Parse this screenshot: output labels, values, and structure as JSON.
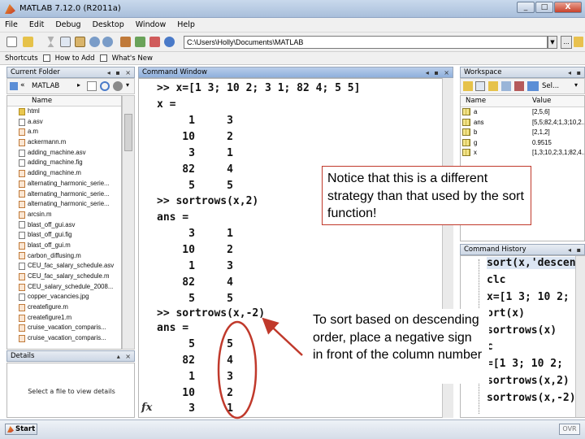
{
  "window": {
    "title": "MATLAB  7.12.0 (R2011a)",
    "minimize": "_",
    "maximize": "□",
    "close": "X"
  },
  "menu": [
    "File",
    "Edit",
    "Debug",
    "Desktop",
    "Window",
    "Help"
  ],
  "toolbar": {
    "current_folder_path": "C:\\Users\\Holly\\Documents\\MATLAB",
    "dropdown_glyph": "▼",
    "browse_label": "..."
  },
  "shortcuts": [
    {
      "label": "Shortcuts"
    },
    {
      "label": "How to Add"
    },
    {
      "label": "What's New"
    }
  ],
  "current_folder": {
    "header": "Current Folder",
    "folder_name": "MATLAB",
    "column_name": "Name",
    "files": [
      {
        "name": "html",
        "kind": "folder"
      },
      {
        "name": "a.asv",
        "kind": "file"
      },
      {
        "name": "a.m",
        "kind": "m"
      },
      {
        "name": "ackermann.m",
        "kind": "m"
      },
      {
        "name": "adding_machine.asv",
        "kind": "file"
      },
      {
        "name": "adding_machine.fig",
        "kind": "file"
      },
      {
        "name": "adding_machine.m",
        "kind": "m"
      },
      {
        "name": "alternating_harmonic_serie...",
        "kind": "m"
      },
      {
        "name": "alternating_harmonic_serie...",
        "kind": "m"
      },
      {
        "name": "alternating_harmonic_serie...",
        "kind": "m"
      },
      {
        "name": "arcsin.m",
        "kind": "m"
      },
      {
        "name": "blast_off_gui.asv",
        "kind": "file"
      },
      {
        "name": "blast_off_gui.fig",
        "kind": "file"
      },
      {
        "name": "blast_off_gui.m",
        "kind": "m"
      },
      {
        "name": "carbon_diffusing.m",
        "kind": "m"
      },
      {
        "name": "CEU_fac_salary_schedule.asv",
        "kind": "file"
      },
      {
        "name": "CEU_fac_salary_schedule.m",
        "kind": "m"
      },
      {
        "name": "CEU_salary_schedule_2008...",
        "kind": "m"
      },
      {
        "name": "copper_vacancies.jpg",
        "kind": "file"
      },
      {
        "name": "createfigure.m",
        "kind": "m"
      },
      {
        "name": "createfigure1.m",
        "kind": "m"
      },
      {
        "name": "cruise_vacation_comparis...",
        "kind": "m"
      },
      {
        "name": "cruise_vacation_comparis...",
        "kind": "m"
      }
    ]
  },
  "details": {
    "header": "Details",
    "empty_text": "Select a file to view details"
  },
  "command_window": {
    "header": "Command Window",
    "lines": [
      ">> x=[1 3; 10 2; 3 1; 82 4; 5 5]",
      "x =",
      "     1     3",
      "    10     2",
      "     3     1",
      "    82     4",
      "     5     5",
      ">> sortrows(x,2)",
      "ans =",
      "     3     1",
      "    10     2",
      "     1     3",
      "    82     4",
      "     5     5",
      ">> sortrows(x,-2)",
      "ans =",
      "     5     5",
      "    82     4",
      "     1     3",
      "    10     2",
      "     3     1"
    ],
    "fx_label": "fx"
  },
  "workspace": {
    "header": "Workspace",
    "select_label": "Sel...",
    "columns": [
      "Name",
      "Value"
    ],
    "variables": [
      {
        "name": "a",
        "value": "[2,5,6]"
      },
      {
        "name": "ans",
        "value": "[5,5;82,4;1,3;10,2..."
      },
      {
        "name": "b",
        "value": "[2,1,2]"
      },
      {
        "name": "g",
        "value": "0.9515"
      },
      {
        "name": "x",
        "value": "[1,3;10,2;3,1;82,4..."
      }
    ]
  },
  "command_history": {
    "header": "Command History",
    "lines": [
      "sort(x,'descen",
      "clc",
      "x=[1 3; 10 2;",
      "ort(x)",
      "sortrows(x)",
      "c",
      "=[1 3; 10 2;",
      "sortrows(x,2)",
      "sortrows(x,-2)"
    ]
  },
  "status": {
    "start_label": "Start",
    "ovr_label": "OVR"
  },
  "annotations": {
    "note_top": "Notice that this is a different strategy than that used by the sort function!",
    "note_bottom": "To sort based on descending order, place a negative sign in front of the column number",
    "arrow_color": "#c0392b",
    "ellipse_color": "#c0392b"
  }
}
